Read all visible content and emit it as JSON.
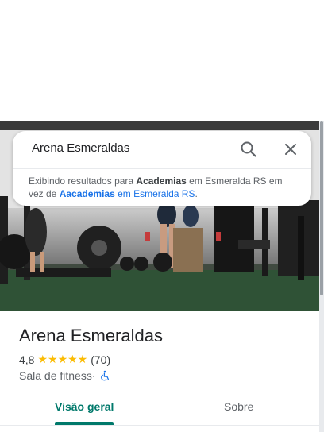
{
  "search": {
    "query": "Arena Esmeraldas",
    "suggest_prefix": "Exibindo resultados para ",
    "suggest_term": "Academias",
    "suggest_middle": " em Esmeralda RS em vez de ",
    "suggest_alt_term": "Aacademias",
    "suggest_alt_location": " em Esmeralda RS",
    "suggest_end": "."
  },
  "place": {
    "name": "Arena Esmeraldas",
    "rating": "4,8",
    "stars": "★★★★★",
    "reviews": "(70)",
    "category": "Sala de fitness",
    "separator": " · "
  },
  "tabs": {
    "overview": "Visão geral",
    "about": "Sobre"
  },
  "colors": {
    "accent": "#00796b",
    "star": "#fbbc04",
    "link": "#1a73e8"
  },
  "icons": {
    "search": "search-icon",
    "close": "close-icon",
    "accessibility": "wheelchair-icon"
  }
}
